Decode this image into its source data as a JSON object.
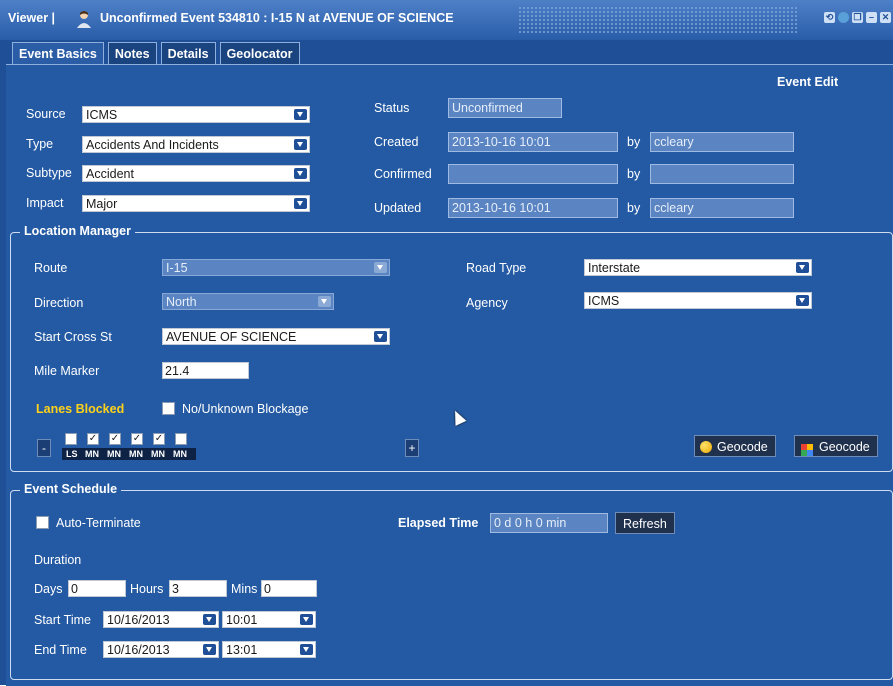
{
  "window": {
    "app": "Viewer |",
    "title": "Unconfirmed Event 534810 : I-15 N at AVENUE OF SCIENCE"
  },
  "tabs": [
    "Event Basics",
    "Notes",
    "Details",
    "Geolocator"
  ],
  "event_edit": "Event Edit",
  "basics": {
    "source": {
      "label": "Source",
      "value": "ICMS"
    },
    "type": {
      "label": "Type",
      "value": "Accidents And Incidents"
    },
    "subtype": {
      "label": "Subtype",
      "value": "Accident"
    },
    "impact": {
      "label": "Impact",
      "value": "Major"
    },
    "status": {
      "label": "Status",
      "value": "Unconfirmed"
    },
    "created": {
      "label": "Created",
      "value": "2013-10-16 10:01",
      "by_label": "by",
      "by": "ccleary"
    },
    "confirmed": {
      "label": "Confirmed",
      "value": "",
      "by_label": "by",
      "by": ""
    },
    "updated": {
      "label": "Updated",
      "value": "2013-10-16 10:01",
      "by_label": "by",
      "by": "ccleary"
    }
  },
  "location": {
    "legend": "Location Manager",
    "route": {
      "label": "Route",
      "value": "I-15"
    },
    "direction": {
      "label": "Direction",
      "value": "North"
    },
    "start_cross": {
      "label": "Start Cross St",
      "value": "AVENUE OF SCIENCE"
    },
    "mile_marker": {
      "label": "Mile Marker",
      "value": "21.4"
    },
    "road_type": {
      "label": "Road Type",
      "value": "Interstate"
    },
    "agency": {
      "label": "Agency",
      "value": "ICMS"
    },
    "lanes_blocked": "Lanes Blocked",
    "no_unknown": "No/Unknown Blockage",
    "lane_codes": [
      "LS",
      "MN",
      "MN",
      "MN",
      "MN",
      "MN"
    ],
    "lane_checks": [
      "",
      "✓",
      "✓",
      "✓",
      "✓",
      ""
    ],
    "minus": "-",
    "plus": "+",
    "geocode1": "Geocode",
    "geocode2": "Geocode"
  },
  "schedule": {
    "legend": "Event Schedule",
    "auto_terminate": "Auto-Terminate",
    "elapsed_label": "Elapsed Time",
    "elapsed_value": "0 d 0 h 0 min",
    "refresh": "Refresh",
    "duration": "Duration",
    "days_label": "Days",
    "days": "0",
    "hours_label": "Hours",
    "hours": "3",
    "mins_label": "Mins",
    "mins": "0",
    "start_label": "Start Time",
    "start_date": "10/16/2013",
    "start_time": "10:01",
    "end_label": "End Time",
    "end_date": "10/16/2013",
    "end_time": "13:01"
  }
}
